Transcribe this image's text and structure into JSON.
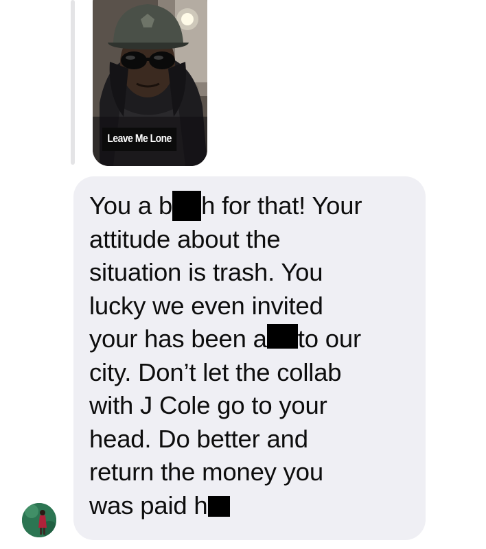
{
  "shared_photo": {
    "caption": "Leave Me Lone"
  },
  "message": {
    "lines": [
      {
        "before": "You a b",
        "redacted": true,
        "after": "h for that! Your"
      },
      {
        "before": "attitude about the",
        "redacted": false,
        "after": ""
      },
      {
        "before": "situation is trash. You",
        "redacted": false,
        "after": ""
      },
      {
        "before": "lucky we even invited",
        "redacted": false,
        "after": ""
      },
      {
        "before": "your has been a",
        "redacted": true,
        "after": "to our"
      },
      {
        "before": "city. Don’t let the collab",
        "redacted": false,
        "after": ""
      },
      {
        "before": "with J Cole go to your",
        "redacted": false,
        "after": ""
      },
      {
        "before": "head. Do better and",
        "redacted": false,
        "after": ""
      },
      {
        "before": "return the money you",
        "redacted": false,
        "after": ""
      },
      {
        "before": "was paid h",
        "redacted": true,
        "after": ""
      }
    ]
  },
  "colors": {
    "bubble_background": "#efeff4",
    "text": "#0d0d0d",
    "redaction": "#000000",
    "reply_line": "#e4e4e6"
  },
  "icons": {
    "avatar": "sender-avatar"
  }
}
